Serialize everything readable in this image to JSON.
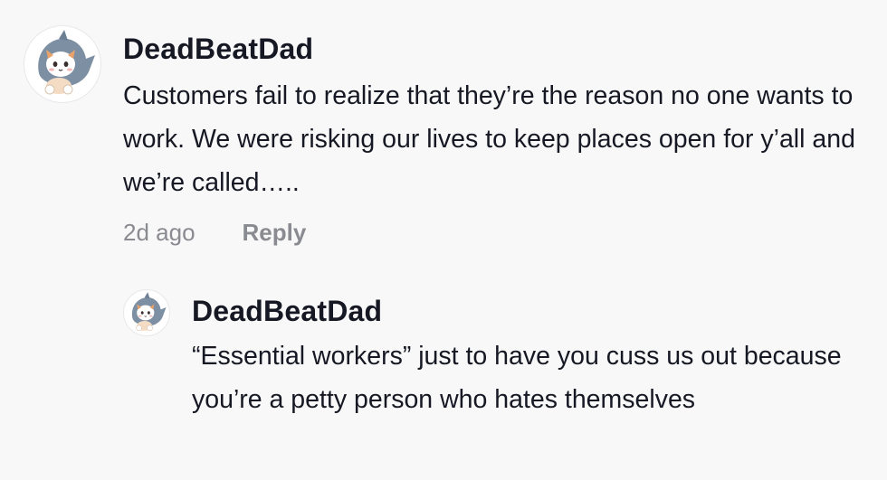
{
  "comments": [
    {
      "avatar_icon": "cat-shark-avatar-icon",
      "username": "DeadBeatDad",
      "text": "Customers fail to realize that they’re the reason no one wants to work. We were risking our lives to keep places open for y’all and we’re called…..",
      "time": "2d ago",
      "reply_label": "Reply"
    }
  ],
  "replies": [
    {
      "avatar_icon": "cat-shark-avatar-icon",
      "username": "DeadBeatDad",
      "text": "“Essential workers” just to have you cuss us out because you’re a petty person who hates themselves"
    }
  ],
  "colors": {
    "background": "#f8f8f8",
    "text_primary": "#161823",
    "text_secondary": "#8a8b91",
    "shark": "#7d8fa3"
  }
}
